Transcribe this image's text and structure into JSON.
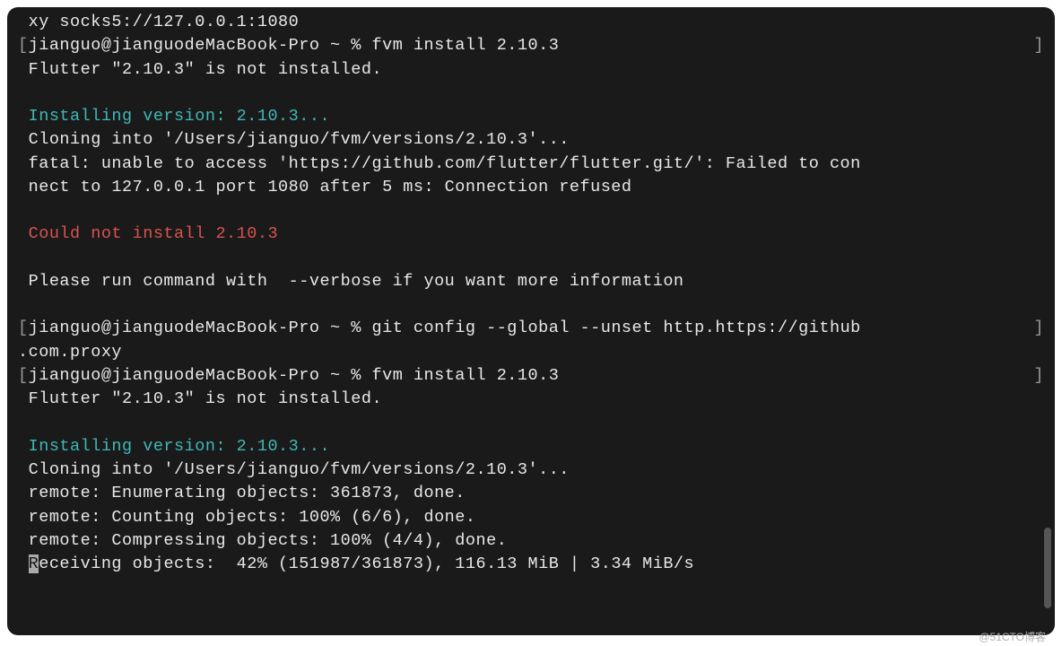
{
  "terminal": {
    "lines": [
      {
        "text": " xy socks5://127.0.0.1:1080",
        "class": ""
      },
      {
        "prefix": "[",
        "prompt": "jianguo@jianguodeMacBook-Pro ~ % ",
        "cmd": "fvm install 2.10.3",
        "suffix": "]"
      },
      {
        "text": " Flutter \"2.10.3\" is not installed.",
        "class": ""
      },
      {
        "text": "",
        "class": ""
      },
      {
        "text": " Installing version: 2.10.3...",
        "class": "cyan"
      },
      {
        "text": " Cloning into '/Users/jianguo/fvm/versions/2.10.3'...",
        "class": ""
      },
      {
        "text": " fatal: unable to access 'https://github.com/flutter/flutter.git/': Failed to con",
        "class": ""
      },
      {
        "text": " nect to 127.0.0.1 port 1080 after 5 ms: Connection refused",
        "class": ""
      },
      {
        "text": "",
        "class": ""
      },
      {
        "text": " Could not install 2.10.3",
        "class": "red"
      },
      {
        "text": "",
        "class": ""
      },
      {
        "text": " Please run command with  --verbose if you want more information",
        "class": ""
      },
      {
        "text": "",
        "class": ""
      },
      {
        "prefix": "[",
        "prompt": "jianguo@jianguodeMacBook-Pro ~ % ",
        "cmd": "git config --global --unset http.https://github",
        "suffix": "]"
      },
      {
        "text": ".com.proxy",
        "class": ""
      },
      {
        "prefix": "[",
        "prompt": "jianguo@jianguodeMacBook-Pro ~ % ",
        "cmd": "fvm install 2.10.3",
        "suffix": "]"
      },
      {
        "text": " Flutter \"2.10.3\" is not installed.",
        "class": ""
      },
      {
        "text": "",
        "class": ""
      },
      {
        "text": " Installing version: 2.10.3...",
        "class": "cyan"
      },
      {
        "text": " Cloning into '/Users/jianguo/fvm/versions/2.10.3'...",
        "class": ""
      },
      {
        "text": " remote: Enumerating objects: 361873, done.",
        "class": ""
      },
      {
        "text": " remote: Counting objects: 100% (6/6), done.",
        "class": ""
      },
      {
        "text": " remote: Compressing objects: 100% (4/4), done.",
        "class": ""
      },
      {
        "cursor": "R",
        "text": "eceiving objects:  42% (151987/361873), 116.13 MiB | 3.34 MiB/s",
        "class": ""
      }
    ]
  },
  "watermark": "@51CTO博客"
}
